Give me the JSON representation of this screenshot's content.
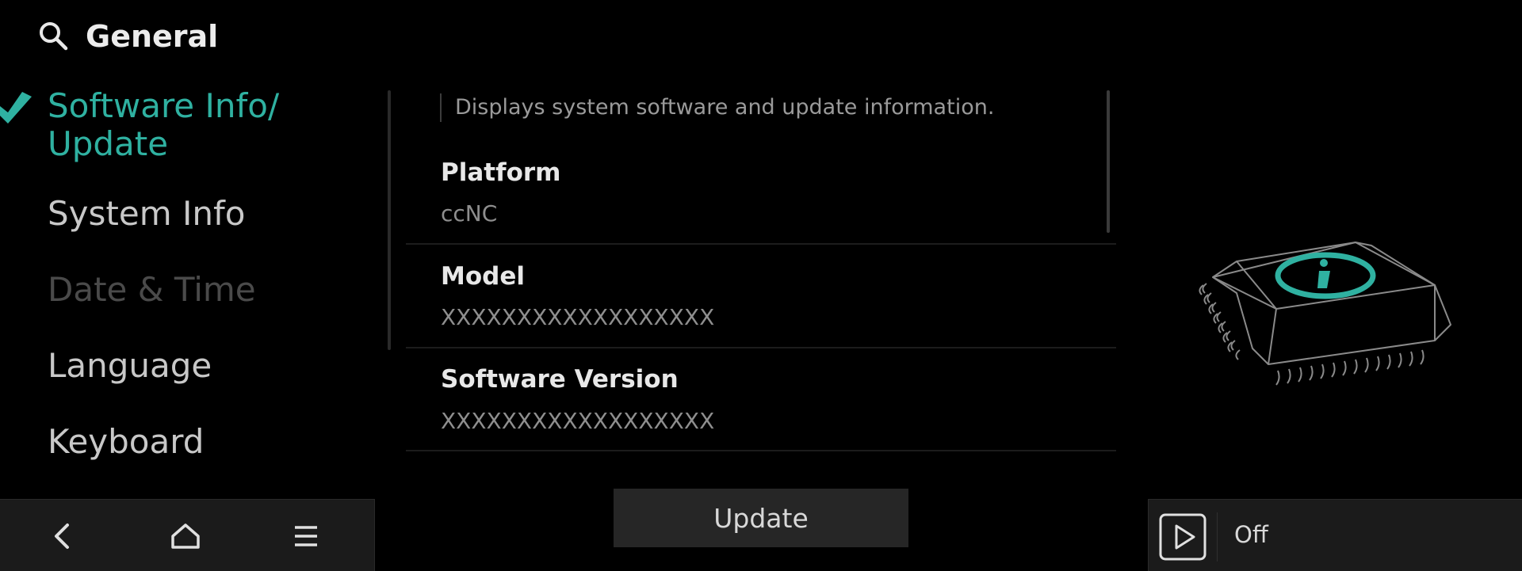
{
  "header": {
    "title": "General",
    "search_icon": "search-icon"
  },
  "menu": {
    "items": [
      {
        "label": "Software Info/",
        "label_line2": "Update",
        "state": "active"
      },
      {
        "label": "System Info",
        "state": "normal"
      },
      {
        "label": "Date & Time",
        "state": "disabled"
      },
      {
        "label": "Language",
        "state": "normal"
      },
      {
        "label": "Keyboard",
        "state": "normal"
      }
    ],
    "active_color": "#2fb1a1",
    "active_icon": "check-icon"
  },
  "detail": {
    "description": "Displays system software and update information.",
    "fields": [
      {
        "label": "Platform",
        "value": "ccNC"
      },
      {
        "label": "Model",
        "value": "XXXXXXXXXXXXXXXXXX"
      },
      {
        "label": "Software Version",
        "value": "XXXXXXXXXXXXXXXXXX"
      }
    ],
    "update_button": "Update",
    "illustration_icon": "chip-info-icon"
  },
  "nav": {
    "back_icon": "back-icon",
    "home_icon": "home-icon",
    "menu_icon": "menu-icon"
  },
  "media": {
    "play_icon": "play-icon",
    "status": "Off"
  }
}
